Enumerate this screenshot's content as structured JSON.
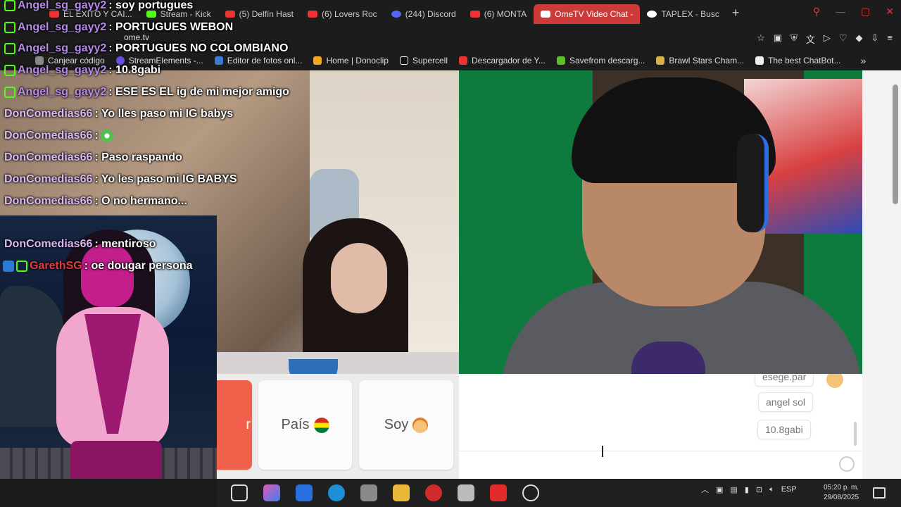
{
  "browser": {
    "tabs": [
      {
        "label": "EL EXITO Y CAI..."
      },
      {
        "label": "Stream - Kick"
      },
      {
        "label": "(5) Delfín Hast"
      },
      {
        "label": "(6) Lovers Roc"
      },
      {
        "label": "(244) Discord"
      },
      {
        "label": "(6) MONTA"
      },
      {
        "label": "OmeTV Video Chat -"
      },
      {
        "label": "TAPLEX - Busc"
      }
    ],
    "url": "ome.tv",
    "bookmarks": [
      {
        "label": "Canjear código"
      },
      {
        "label": "StreamElements -..."
      },
      {
        "label": "Editor de fotos onl..."
      },
      {
        "label": "Home | Donoclip"
      },
      {
        "label": "Supercell"
      },
      {
        "label": "Descargador de Y..."
      },
      {
        "label": "Savefrom descarg..."
      },
      {
        "label": "Brawl Stars Cham..."
      },
      {
        "label": "The best ChatBot..."
      }
    ]
  },
  "stream_chat": [
    {
      "user": "Angel_sg_gayy2",
      "text": ": soy portugues"
    },
    {
      "user": "Angel_sg_gayy2",
      "text": ": PORTUGUES WEBON"
    },
    {
      "user": "Angel_sg_gayy2",
      "text": ": PORTUGUES NO COLOMBIANO"
    },
    {
      "user": "Angel_sg_gayy2",
      "text": ": 10.8gabi"
    },
    {
      "user": "Angel_sg_gayy2",
      "text": ": ESE ES EL ig de mi mejor amigo"
    },
    {
      "user": "DonComedias66",
      "text": ": Yo lles paso mi IG babys"
    },
    {
      "user": "DonComedias66",
      "text": ":"
    },
    {
      "user": "DonComedias66",
      "text": ": Paso raspando"
    },
    {
      "user": "DonComedias66",
      "text": ": Yo les paso mi IG BABYS"
    },
    {
      "user": "DonComedias66",
      "text": ": O no hermano..."
    },
    {
      "user": "DonComedias66",
      "text": ": mentiroso"
    },
    {
      "user": "GarethSG",
      "text": ": oe dougar persona"
    }
  ],
  "ometv": {
    "next_label": "r",
    "country_label": "País",
    "gender_label": "Soy",
    "chat_messages": [
      "esege.par",
      "angel sol",
      "10.8gabi"
    ]
  },
  "taskbar": {
    "language": "ESP",
    "time": "05:20 p. m.",
    "date": "29/08/2025"
  }
}
